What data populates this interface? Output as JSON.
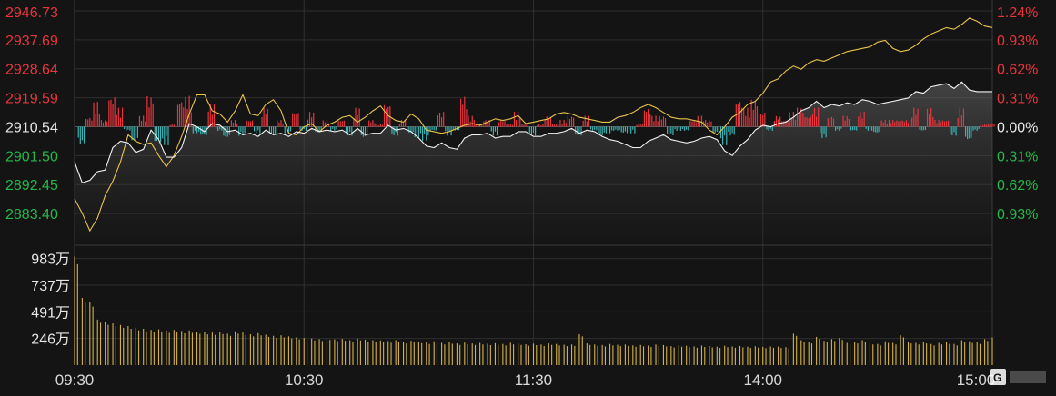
{
  "chart_data": {
    "type": "line",
    "price_axis": {
      "ylim": [
        2874.35,
        2946.73
      ],
      "base": 2910.54,
      "left_ticks": [
        "2946.73",
        "2937.69",
        "2928.64",
        "2919.59",
        "2910.54",
        "2901.50",
        "2892.45",
        "2883.40"
      ],
      "right_ticks": [
        "1.24%",
        "0.93%",
        "0.62%",
        "0.31%",
        "0.00%",
        "0.31%",
        "0.62%",
        "0.93%"
      ],
      "tick_directions": [
        "up",
        "up",
        "up",
        "up",
        "flat",
        "down",
        "down",
        "down"
      ]
    },
    "volume_axis": {
      "ticks": [
        "983万",
        "737万",
        "491万",
        "246万"
      ],
      "tick_values": [
        983,
        737,
        491,
        246
      ],
      "ylim": [
        0,
        1080
      ],
      "unit": "万"
    },
    "x_ticks": [
      "09:30",
      "10:30",
      "11:30",
      "14:00",
      "15:00"
    ],
    "series": [
      {
        "kind": "white_line",
        "x": [
          0,
          2,
          4,
          6,
          8,
          10,
          12,
          14,
          16,
          18,
          20,
          22,
          24,
          26,
          28,
          30,
          32,
          34,
          36,
          38,
          40,
          42,
          44,
          46,
          48,
          50,
          52,
          54,
          56,
          58,
          60,
          62,
          64,
          66,
          68,
          70,
          72,
          74,
          76,
          78,
          80,
          82,
          84,
          86,
          88,
          90,
          92,
          94,
          96,
          98,
          100,
          102,
          104,
          106,
          108,
          110,
          112,
          114,
          116,
          118,
          120,
          122,
          124,
          126,
          128,
          130,
          132,
          134,
          136,
          138,
          140,
          142,
          144,
          146,
          148,
          150,
          152,
          154,
          156,
          158,
          160,
          162,
          164,
          166,
          168,
          170,
          172,
          174,
          176,
          178,
          180,
          182,
          184,
          186,
          188,
          190,
          192,
          194,
          196,
          198,
          200,
          202,
          204,
          206,
          208,
          210,
          212,
          214,
          216,
          218,
          220,
          222,
          224,
          226,
          228,
          230,
          232,
          234,
          236,
          238,
          240
        ],
        "values": [
          2899.5,
          2893.0,
          2893.8,
          2896.5,
          2897.0,
          2904.0,
          2906.0,
          2905.5,
          2902.5,
          2903.5,
          2909.5,
          2906.5,
          2901.0,
          2901.0,
          2904.0,
          2911.5,
          2910.5,
          2909.0,
          2911.5,
          2911.0,
          2909.0,
          2909.5,
          2908.0,
          2908.5,
          2907.5,
          2909.5,
          2908.0,
          2908.5,
          2907.5,
          2909.0,
          2908.5,
          2910.0,
          2909.0,
          2909.5,
          2909.0,
          2909.5,
          2908.0,
          2910.0,
          2908.0,
          2908.5,
          2908.5,
          2911.0,
          2909.5,
          2910.0,
          2909.0,
          2907.0,
          2904.5,
          2904.0,
          2905.5,
          2904.0,
          2903.5,
          2907.0,
          2908.0,
          2908.0,
          2908.5,
          2907.0,
          2907.5,
          2907.5,
          2909.0,
          2909.0,
          2907.5,
          2907.5,
          2908.5,
          2908.5,
          2909.0,
          2910.0,
          2908.5,
          2909.5,
          2909.0,
          2907.5,
          2906.5,
          2906.0,
          2905.0,
          2904.0,
          2904.0,
          2906.0,
          2907.0,
          2908.0,
          2906.5,
          2906.0,
          2905.5,
          2906.0,
          2907.0,
          2907.5,
          2906.5,
          2903.0,
          2901.5,
          2904.5,
          2906.5,
          2909.5,
          2911.0,
          2910.5,
          2911.5,
          2912.0,
          2913.5,
          2915.5,
          2916.5,
          2918.5,
          2916.5,
          2917.5,
          2917.0,
          2918.0,
          2917.5,
          2919.0,
          2918.5,
          2917.5,
          2918.0,
          2918.5,
          2919.0,
          2919.5,
          2921.5,
          2921.0,
          2923.0,
          2923.5,
          2924.0,
          2922.5,
          2924.5,
          2922.0,
          2921.5,
          2921.5,
          2921.5
        ]
      },
      {
        "kind": "yellow_line",
        "x": [
          0,
          2,
          4,
          6,
          8,
          10,
          12,
          14,
          16,
          18,
          20,
          22,
          24,
          26,
          28,
          30,
          32,
          34,
          36,
          38,
          40,
          42,
          44,
          46,
          48,
          50,
          52,
          54,
          56,
          58,
          60,
          62,
          64,
          66,
          68,
          70,
          72,
          74,
          76,
          78,
          80,
          82,
          84,
          86,
          88,
          90,
          92,
          94,
          96,
          98,
          100,
          102,
          104,
          106,
          108,
          110,
          112,
          114,
          116,
          118,
          120,
          122,
          124,
          126,
          128,
          130,
          132,
          134,
          136,
          138,
          140,
          142,
          144,
          146,
          148,
          150,
          152,
          154,
          156,
          158,
          160,
          162,
          164,
          166,
          168,
          170,
          172,
          174,
          176,
          178,
          180,
          182,
          184,
          186,
          188,
          190,
          192,
          194,
          196,
          198,
          200,
          202,
          204,
          206,
          208,
          210,
          212,
          214,
          216,
          218,
          220,
          222,
          224,
          226,
          228,
          230,
          232,
          234,
          236,
          238,
          240
        ],
        "values": [
          2888.0,
          2883.5,
          2878.0,
          2882.0,
          2889.0,
          2893.5,
          2899.5,
          2908.0,
          2906.0,
          2905.0,
          2905.5,
          2901.5,
          2898.0,
          2901.5,
          2907.5,
          2914.5,
          2920.5,
          2920.5,
          2915.5,
          2914.5,
          2912.0,
          2915.5,
          2920.5,
          2914.5,
          2914.0,
          2917.5,
          2919.0,
          2915.5,
          2908.5,
          2908.0,
          2910.5,
          2911.5,
          2909.0,
          2911.0,
          2912.0,
          2913.5,
          2914.0,
          2912.0,
          2913.5,
          2915.5,
          2917.0,
          2914.0,
          2912.5,
          2912.0,
          2914.5,
          2913.0,
          2909.5,
          2909.0,
          2908.5,
          2909.0,
          2910.0,
          2911.0,
          2911.5,
          2911.0,
          2912.0,
          2913.0,
          2912.5,
          2913.0,
          2914.0,
          2911.5,
          2912.0,
          2912.5,
          2913.0,
          2914.5,
          2915.0,
          2914.5,
          2913.5,
          2913.0,
          2912.5,
          2912.0,
          2912.0,
          2913.5,
          2914.0,
          2915.0,
          2916.5,
          2917.5,
          2916.5,
          2915.0,
          2913.5,
          2913.0,
          2913.0,
          2912.5,
          2912.0,
          2909.5,
          2908.0,
          2910.5,
          2913.5,
          2915.0,
          2917.5,
          2918.5,
          2921.0,
          2924.5,
          2925.5,
          2928.0,
          2929.5,
          2928.5,
          2930.5,
          2931.5,
          2931.0,
          2932.0,
          2933.0,
          2934.0,
          2934.5,
          2935.0,
          2935.5,
          2937.0,
          2937.5,
          2935.0,
          2934.0,
          2934.5,
          2936.0,
          2938.0,
          2939.5,
          2940.5,
          2941.5,
          2941.0,
          2942.5,
          2944.5,
          2943.5,
          2942.0,
          2941.5
        ]
      }
    ],
    "volume": [
      1000,
      620,
      580,
      420,
      400,
      385,
      370,
      360,
      345,
      335,
      325,
      330,
      320,
      325,
      315,
      320,
      310,
      305,
      300,
      308,
      290,
      312,
      300,
      285,
      295,
      280,
      270,
      275,
      265,
      255,
      250,
      245,
      240,
      250,
      238,
      242,
      230,
      245,
      235,
      230,
      228,
      222,
      230,
      215,
      225,
      218,
      210,
      220,
      205,
      212,
      200,
      208,
      200,
      205,
      198,
      202,
      195,
      205,
      200,
      192,
      198,
      190,
      200,
      195,
      188,
      190,
      285,
      200,
      190,
      185,
      195,
      188,
      190,
      182,
      186,
      180,
      190,
      185,
      175,
      182,
      178,
      172,
      180,
      176,
      170,
      178,
      172,
      176,
      170,
      174,
      168,
      172,
      170,
      166,
      290,
      230,
      215,
      260,
      225,
      240,
      250,
      205,
      215,
      230,
      205,
      195,
      220,
      205,
      275,
      215,
      205,
      215,
      195,
      205,
      210,
      195,
      230,
      220,
      210,
      240,
      255
    ]
  }
}
